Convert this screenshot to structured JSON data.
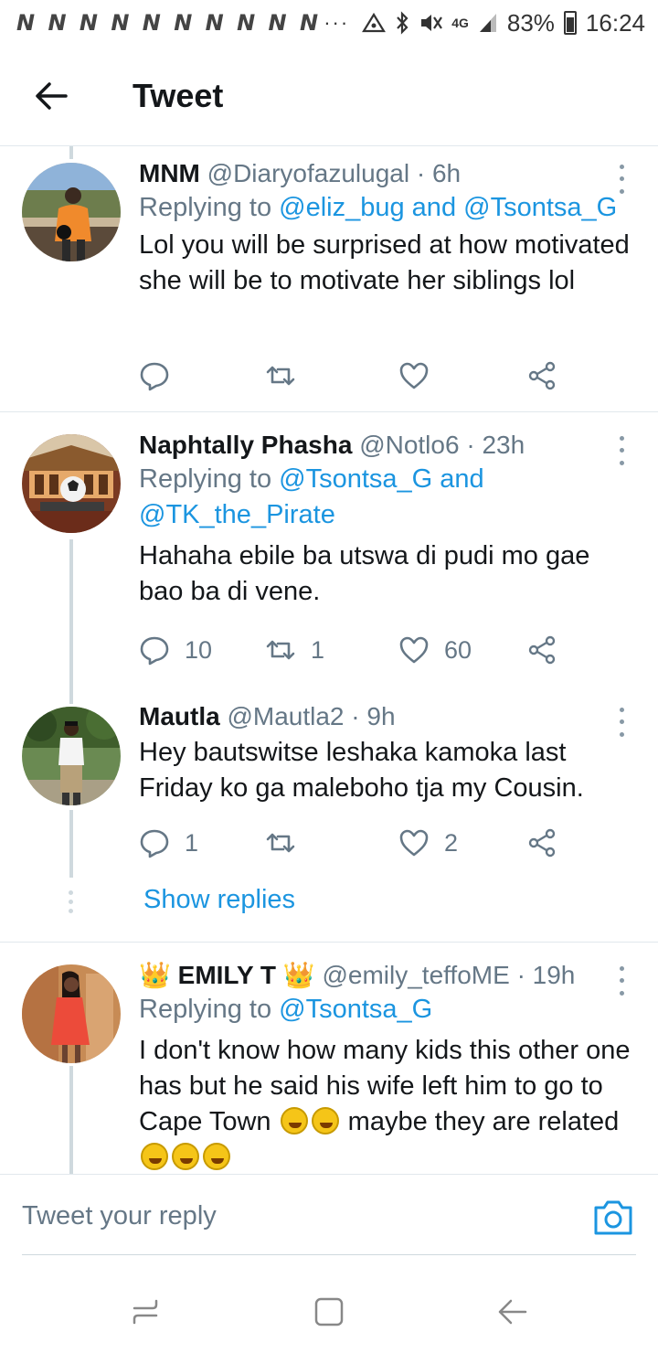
{
  "status_bar": {
    "notifications": "N N N N N N N N N N",
    "more": "···",
    "network": "4G",
    "battery": "83%",
    "time": "16:24"
  },
  "header": {
    "title": "Tweet"
  },
  "tweets": [
    {
      "name": "MNM",
      "handle": "@Diaryofazulugal",
      "time": "· 6h",
      "replying_prefix": "Replying to ",
      "replying_to_1": "@eliz_bug",
      "replying_and": " and ",
      "replying_to_2": "@Tsontsa_G",
      "text": "Lol you will be surprised at how motivated she will be to motivate her siblings lol",
      "replies": "",
      "retweets": "",
      "likes": ""
    },
    {
      "name": "Naphtally Phasha",
      "handle": "@Notlo6",
      "time": "· 23h",
      "replying_prefix": "Replying to ",
      "replying_to_1": "@Tsontsa_G",
      "replying_and": " and ",
      "replying_to_2": "@TK_the_Pirate",
      "text": "Hahaha ebile ba utswa di pudi mo gae bao ba di vene.",
      "replies": "10",
      "retweets": "1",
      "likes": "60"
    },
    {
      "name": "Mautla",
      "handle": "@Mautla2",
      "time": "· 9h",
      "text": "Hey bautswitse leshaka kamoka last Friday ko ga maleboho tja my Cousin.",
      "replies": "1",
      "retweets": "",
      "likes": "2"
    },
    {
      "name_prefix": "👑",
      "name": "EMILY T",
      "name_suffix": "👑",
      "handle": "@emily_teffoME",
      "time": "· 19h",
      "replying_prefix": "Replying to ",
      "replying_to_1": "@Tsontsa_G",
      "text_1": "I don't know how many kids this other one has but he said his wife left him to go to Cape Town ",
      "text_2": " maybe they are related "
    }
  ],
  "show_replies": "Show replies",
  "compose": {
    "placeholder": "Tweet your reply"
  },
  "colors": {
    "accent": "#1b95e0",
    "secondary_text": "#657786",
    "primary_text": "#14171a",
    "divider": "#e1e8ed"
  },
  "icons": [
    "back-arrow-icon",
    "more-vertical-icon",
    "reply-icon",
    "retweet-icon",
    "like-icon",
    "share-icon",
    "camera-icon",
    "recents-icon",
    "home-icon",
    "nav-back-icon"
  ]
}
